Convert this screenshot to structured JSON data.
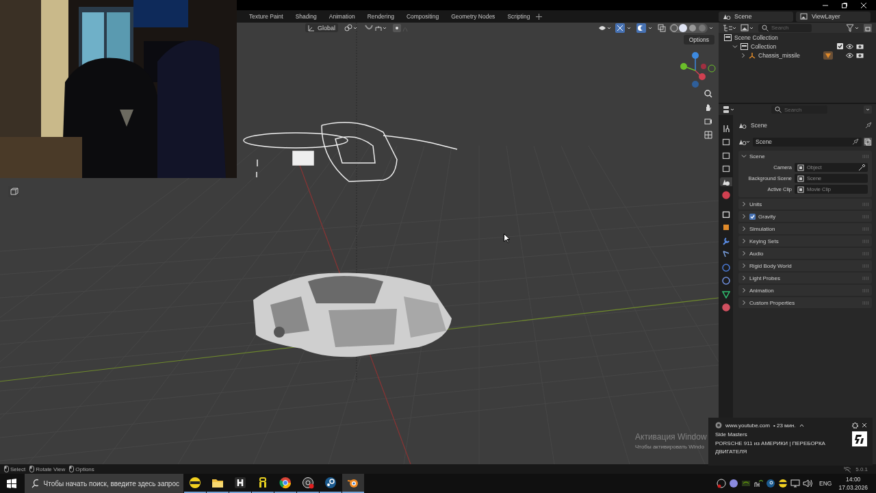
{
  "workspace_tabs": [
    {
      "label": "Texture Paint"
    },
    {
      "label": "Shading"
    },
    {
      "label": "Animation"
    },
    {
      "label": "Rendering"
    },
    {
      "label": "Compositing"
    },
    {
      "label": "Geometry Nodes"
    },
    {
      "label": "Scripting"
    }
  ],
  "scene_selector": {
    "value": "Scene"
  },
  "view_layer_selector": {
    "value": "ViewLayer"
  },
  "viewport": {
    "orientation": "Global",
    "options_label": "Options"
  },
  "outliner": {
    "search": {
      "placeholder": "Search"
    },
    "tree": [
      {
        "kind": "scene_collection",
        "label": "Scene Collection",
        "children": [
          {
            "kind": "collection",
            "label": "Collection",
            "expanded": true,
            "checked": true,
            "children": [
              {
                "kind": "object",
                "label": "Chassis_missile",
                "expanded": false
              }
            ]
          }
        ]
      }
    ]
  },
  "properties": {
    "search": {
      "placeholder": "Search"
    },
    "context_title": "Scene",
    "datablock": "Scene",
    "tabs": [
      {
        "kind": "tool",
        "selected": false
      },
      {
        "kind": "render",
        "selected": false
      },
      {
        "kind": "output",
        "selected": false
      },
      {
        "kind": "view_layer",
        "selected": false
      },
      {
        "kind": "scene",
        "selected": true
      },
      {
        "kind": "world",
        "selected": false
      },
      {
        "kind": "collection",
        "selected": false
      },
      {
        "kind": "object",
        "selected": false
      },
      {
        "kind": "modifiers",
        "selected": false
      },
      {
        "kind": "particles",
        "selected": false
      },
      {
        "kind": "physics",
        "selected": false
      },
      {
        "kind": "constraints",
        "selected": false
      },
      {
        "kind": "data",
        "selected": false
      },
      {
        "kind": "material",
        "selected": false
      }
    ],
    "panels": [
      {
        "kind": "fields",
        "label": "Scene",
        "expanded": true,
        "fields": [
          {
            "label": "Camera",
            "placeholder": "Object"
          },
          {
            "label": "Background Scene",
            "placeholder": "Scene"
          },
          {
            "label": "Active Clip",
            "placeholder": "Movie Clip"
          }
        ]
      },
      {
        "kind": "plain",
        "label": "Units",
        "expanded": false
      },
      {
        "kind": "toggle",
        "label": "Gravity",
        "expanded": false,
        "checked": true
      },
      {
        "kind": "plain",
        "label": "Simulation",
        "expanded": false
      },
      {
        "kind": "plain",
        "label": "Keying Sets",
        "expanded": false
      },
      {
        "kind": "plain",
        "label": "Audio",
        "expanded": false
      },
      {
        "kind": "plain",
        "label": "Rigid Body World",
        "expanded": false
      },
      {
        "kind": "plain",
        "label": "Light Probes",
        "expanded": false
      },
      {
        "kind": "plain",
        "label": "Animation",
        "expanded": false
      },
      {
        "kind": "plain",
        "label": "Custom Properties",
        "expanded": false
      }
    ]
  },
  "status_bar": {
    "hints": [
      "Select",
      "Rotate View",
      "Options"
    ],
    "version": "5.0.1"
  },
  "activation_notice": {
    "title": "Активация Window",
    "body": "Чтобы активировать Windo"
  },
  "notification": {
    "source": "www.youtube.com",
    "age": "• 23 мин.",
    "title": "Side Masters",
    "body": "PORSCHE 911 из АМЕРИКИ | ПЕРЕБОРКА ДВИГАТЕЛЯ"
  },
  "taskbar": {
    "search": {
      "placeholder": "Чтобы начать поиск, введите здесь запрос"
    },
    "apps": [
      {
        "kind": "round",
        "selected": false
      },
      {
        "kind": "folder",
        "selected": false
      },
      {
        "kind": "dark",
        "selected": false
      },
      {
        "kind": "yellow",
        "selected": false
      },
      {
        "kind": "browser",
        "selected": false
      },
      {
        "kind": "record",
        "selected": false
      },
      {
        "kind": "steam",
        "selected": false
      },
      {
        "kind": "orbit",
        "selected": true
      }
    ],
    "language": "ENG",
    "time": "14:00",
    "date": "17.03.2026"
  }
}
